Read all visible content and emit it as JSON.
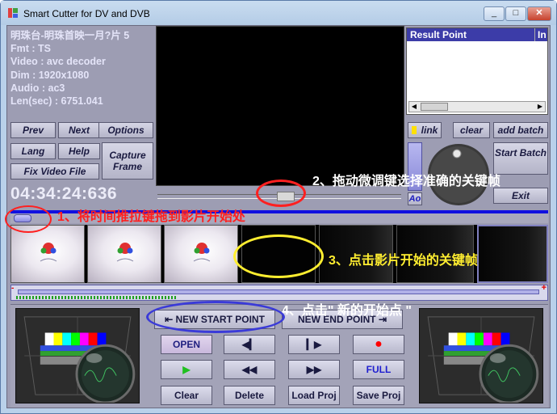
{
  "window": {
    "title": "Smart Cutter for DV and DVB",
    "minimize": "_",
    "maximize": "□",
    "close": "✕"
  },
  "info": {
    "channel": "明珠台-明珠首映一月?片 5",
    "fmt": "Fmt : TS",
    "video": "Video : avc decoder",
    "dim": "Dim : 1920x1080",
    "audio": "Audio : ac3",
    "len": "Len(sec) : 6751.041"
  },
  "nav": {
    "prev": "Prev",
    "next": "Next",
    "options": "Options",
    "lang": "Lang",
    "help": "Help",
    "capture_frame": "Capture Frame",
    "fix_video_file": "Fix Video File"
  },
  "timecode": "04:34:24:636",
  "result_panel": {
    "header": "Result Point",
    "header_col2": "In"
  },
  "side": {
    "link": "link",
    "clear": "clear",
    "add_batch": "add batch",
    "start_batch": "Start Batch",
    "exit": "Exit",
    "ao": "Ao"
  },
  "controls": {
    "new_start_point": "NEW START POINT",
    "new_end_point": "NEW END POINT",
    "open": "OPEN",
    "full": "FULL",
    "clear": "Clear",
    "delete": "Delete",
    "load_proj": "Load Proj",
    "save_proj": "Save Proj"
  },
  "annotations": {
    "step1": "1、将时间推拉键拖到影片开始处",
    "step2": "2、拖动微调键选择准确的关键帧",
    "step3": "3、点击影片开始的关键帧",
    "step4": "4、点击\" 新的开始点 \""
  },
  "colors": {
    "panel": "#9d9db3",
    "accent_blue": "#1010e0",
    "annotation_red": "#ff2020",
    "annotation_yellow": "#ffee30",
    "annotation_blue": "#3a3ad8"
  }
}
